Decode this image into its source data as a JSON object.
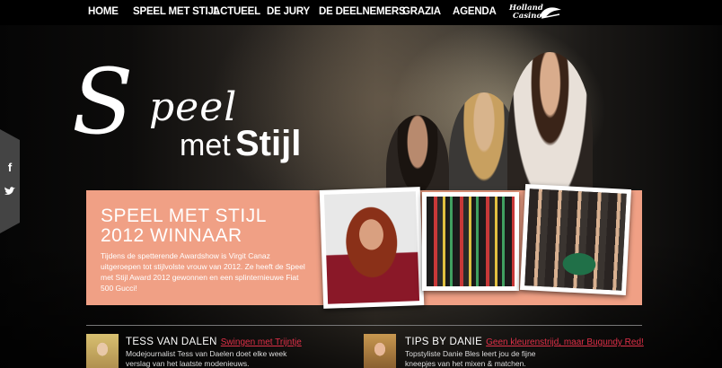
{
  "nav": {
    "items": [
      "HOME",
      "SPEEL MET STIJL",
      "ACTUEEL",
      "DE JURY",
      "DE DEELNEMERS",
      "GRAZIA",
      "AGENDA"
    ],
    "sponsor_line1": "Holland",
    "sponsor_line2": "Casino"
  },
  "share": {
    "facebook": "f",
    "twitter": "twitter-bird"
  },
  "logo": {
    "s": "S",
    "peel": "peel",
    "met": "met",
    "stijl": "Stijl"
  },
  "panel": {
    "title_line1": "SPEEL MET STIJL",
    "title_line2": "2012  WINNAAR",
    "text": "Tijdens de spetterende Awardshow is Virgit Canaz uitgeroepen tot stijlvolste vrouw van 2012. Ze heeft de Speel met Stijl Award 2012 gewonnen en een splinternieuwe Fiat 500 Gucci!"
  },
  "news": [
    {
      "title": "TESS VAN DALEN",
      "link": "Swingen met Trijntje",
      "text": "Modejournalist Tess van Daelen doet elke week verslag van het laatste modenieuws."
    },
    {
      "title": "TIPS BY DANIE",
      "link": "Geen kleurenstrijd, maar Bugundy Red!",
      "text": "Topstyliste Danie Bles leert jou de fijne kneepjes van het mixen & matchen."
    }
  ],
  "colors": {
    "panel": "#f0a085",
    "link": "#e03048"
  }
}
